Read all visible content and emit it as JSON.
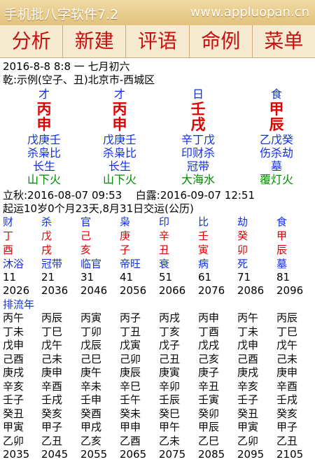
{
  "title_bar": {
    "app_title": "手机批八字软件7.2",
    "url": "www.appluopan.cn"
  },
  "menu": [
    "分析",
    "新建",
    "评语",
    "命例",
    "菜单"
  ],
  "header": {
    "date_line": "2016-8-8 8:8 一 七月初六",
    "qian_line": "乾:示例(空子、丑)北京市-西城区"
  },
  "pillars": [
    {
      "god": "才",
      "stem": "丙",
      "branch": "申",
      "hidden": "戊庚壬",
      "hidden_gods": "杀枭比",
      "stage": "长生",
      "nayin": "山下火"
    },
    {
      "god": "才",
      "stem": "丙",
      "branch": "申",
      "hidden": "戊庚壬",
      "hidden_gods": "杀枭比",
      "stage": "长生",
      "nayin": "山下火"
    },
    {
      "god": "日",
      "stem": "壬",
      "branch": "戌",
      "hidden": "辛丁戊",
      "hidden_gods": "印财杀",
      "stage": "冠带",
      "nayin": "大海水"
    },
    {
      "god": "食",
      "stem": "甲",
      "branch": "辰",
      "hidden": "乙戊癸",
      "hidden_gods": "伤杀劫",
      "stage": "墓",
      "nayin": "覆灯火"
    }
  ],
  "jieqi": {
    "lichun": "立秋:2016-08-07 09:53",
    "bailu": "白露:2016-09-07 12:51"
  },
  "qiyun": "起运10岁0个月23天,8月31日交运(公历)",
  "dayun": {
    "gods": [
      "财",
      "杀",
      "官",
      "枭",
      "印",
      "比",
      "劫",
      "食"
    ],
    "stems": [
      "丁",
      "戊",
      "己",
      "庚",
      "辛",
      "壬",
      "癸",
      "甲"
    ],
    "branches": [
      "酉",
      "戌",
      "亥",
      "子",
      "丑",
      "寅",
      "卯",
      "辰"
    ],
    "stages": [
      "沐浴",
      "冠带",
      "临官",
      "帝旺",
      "衰",
      "病",
      "死",
      "墓"
    ],
    "ages": [
      "11",
      "21",
      "31",
      "41",
      "51",
      "61",
      "71",
      "81"
    ],
    "years": [
      "2026",
      "2036",
      "2046",
      "2056",
      "2066",
      "2076",
      "2086",
      "2096"
    ]
  },
  "liunian": {
    "label": "排流年",
    "rows": [
      [
        "丙午",
        "丙辰",
        "丙寅",
        "丙子",
        "丙戌",
        "丙申",
        "丙午",
        "丙辰"
      ],
      [
        "丁未",
        "丁巳",
        "丁卯",
        "丁丑",
        "丁亥",
        "丁酉",
        "丁未",
        "丁巳"
      ],
      [
        "戊申",
        "戊午",
        "戊辰",
        "戊寅",
        "戊子",
        "戊戌",
        "戊申",
        "戊午"
      ],
      [
        "己酉",
        "己未",
        "己巳",
        "己卯",
        "己丑",
        "己亥",
        "己酉",
        "己未"
      ],
      [
        "庚戌",
        "庚申",
        "庚午",
        "庚辰",
        "庚寅",
        "庚子",
        "庚戌",
        "庚申"
      ],
      [
        "辛亥",
        "辛酉",
        "辛未",
        "辛巳",
        "辛卯",
        "辛丑",
        "辛亥",
        "辛酉"
      ],
      [
        "壬子",
        "壬戌",
        "壬申",
        "壬午",
        "壬辰",
        "壬寅",
        "壬子",
        "壬戌"
      ],
      [
        "癸丑",
        "癸亥",
        "癸酉",
        "癸未",
        "癸巳",
        "癸卯",
        "癸丑",
        "癸亥"
      ],
      [
        "甲寅",
        "甲子",
        "甲戌",
        "甲申",
        "甲午",
        "甲辰",
        "甲寅",
        "甲子"
      ],
      [
        "乙卯",
        "乙丑",
        "乙亥",
        "乙酉",
        "乙未",
        "乙巳",
        "乙卯",
        "乙丑"
      ],
      [
        "2035",
        "2045",
        "2055",
        "2065",
        "2075",
        "2085",
        "2095",
        "2105"
      ]
    ]
  },
  "colors": {
    "red": "#e00000",
    "blue": "#1030e0",
    "green": "#008a00",
    "menu_text": "#c81010"
  }
}
